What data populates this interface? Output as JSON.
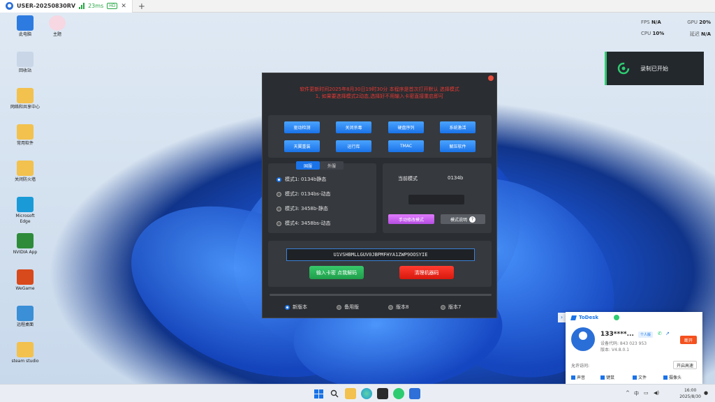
{
  "client": {
    "tab_title": "USER-20250830RV",
    "ping": "23ms",
    "quality": "HD",
    "close": "✕",
    "add_tab": "+"
  },
  "stats": {
    "fps_label": "FPS",
    "fps_value": "N/A",
    "gpu_label": "GPU",
    "gpu_value": "20%",
    "cpu_label": "CPU",
    "cpu_value": "10%",
    "latency_label": "延迟",
    "latency_value": "N/A"
  },
  "desktop_icons": [
    {
      "label": "此电脑",
      "color": "#2d7be0"
    },
    {
      "label": "回收站",
      "color": "#c9d6e8"
    },
    {
      "label": "网络和共享中心",
      "color": "#f2c14e"
    },
    {
      "label": "常用软件",
      "color": "#f2c14e"
    },
    {
      "label": "关闭防火墙",
      "color": "#f2c14e"
    },
    {
      "label": "Microsoft Edge",
      "color": "#1a9bd8"
    },
    {
      "label": "NVIDIA App",
      "color": "#2e8b3a"
    },
    {
      "label": "WeGame",
      "color": "#d8491b"
    },
    {
      "label": "远程桌面",
      "color": "#3a8fd6"
    },
    {
      "label": "steam studio",
      "color": "#f2c14e"
    }
  ],
  "second_icon": {
    "label": "主题",
    "color": "#f6d7e2"
  },
  "toast": {
    "text": "录制已开始"
  },
  "app": {
    "notice_line1": "软件更新时间2025年8月30日19时30分  本程序是首次打开默认 选择模式",
    "notice_line2": "1, 如果要选择模式2动态,选择好不用输入卡密直接重启即可",
    "buttons_row1": [
      "驱动检测",
      "关闭杀毒",
      "硬盘序列",
      "系统激活"
    ],
    "buttons_row2": [
      "天翼重装",
      "运行库",
      "TMAC",
      "解压软件"
    ],
    "tab_active": "国服",
    "tab_other": "外服",
    "modes": [
      {
        "label": "模式1: 0134b静态",
        "selected": true
      },
      {
        "label": "模式2: 0134bs-动态",
        "selected": false
      },
      {
        "label": "模式3: 3458b-静态",
        "selected": false
      },
      {
        "label": "模式4: 3458bs-动态",
        "selected": false
      }
    ],
    "current_mode_label": "当前模式",
    "current_mode_value": "0134b",
    "manual_mode_button": "手动修改模式",
    "mode_help_button": "模式说明",
    "help_glyph": "?",
    "code_value": "U1VSHBMLLGUV0JBPMFHYA1ZWP9OOSYIE",
    "enter_code_button": "输入卡密 点我解码",
    "clean_button": "清理机器码",
    "versions": [
      {
        "label": "新版本",
        "selected": true
      },
      {
        "label": "备用版",
        "selected": false
      },
      {
        "label": "版本8",
        "selected": false
      },
      {
        "label": "版本7",
        "selected": false
      }
    ]
  },
  "todesk": {
    "brand": "ToDesk",
    "device_id": "133****...",
    "badge": "个人版",
    "device_code_line": "设备代码: 843 023 953",
    "version_line": "版本: V4.8.0.1",
    "open_button": "断开",
    "allow_label": "允许访问:",
    "settings_button": "开启高速",
    "checks": [
      "声音",
      "键鼠",
      "文件",
      "摄像头"
    ],
    "arrow": "›"
  },
  "taskbar": {
    "tray_arrow": "^",
    "ime": "中",
    "time": "16:00",
    "date": "2025/8/30"
  }
}
